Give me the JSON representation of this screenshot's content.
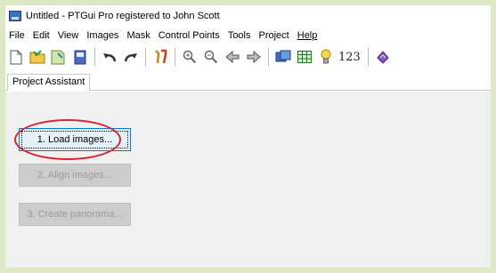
{
  "window": {
    "title": "Untitled - PTGui Pro registered to John Scott"
  },
  "menubar": {
    "items": [
      "File",
      "Edit",
      "View",
      "Images",
      "Mask",
      "Control Points",
      "Tools",
      "Project"
    ],
    "help_label": "Help"
  },
  "toolbar": {
    "icons": [
      "new-project-icon",
      "open-project-icon",
      "save-project-icon",
      "save-as-icon",
      "undo-icon",
      "redo-icon",
      "tools-icon",
      "zoom-in-icon",
      "zoom-out-icon",
      "back-icon",
      "forward-icon",
      "panorama-editor-icon",
      "table-icon",
      "tip-icon",
      "numbers-label",
      "manual-icon"
    ],
    "numbers_label": "123"
  },
  "tabs": {
    "active": "Project Assistant"
  },
  "assistant": {
    "step1": "1. Load images...",
    "step2": "2. Align images...",
    "step3": "3. Create panorama..."
  },
  "colors": {
    "highlight": "#d8212b",
    "outer_frame": "#dde8c5"
  }
}
